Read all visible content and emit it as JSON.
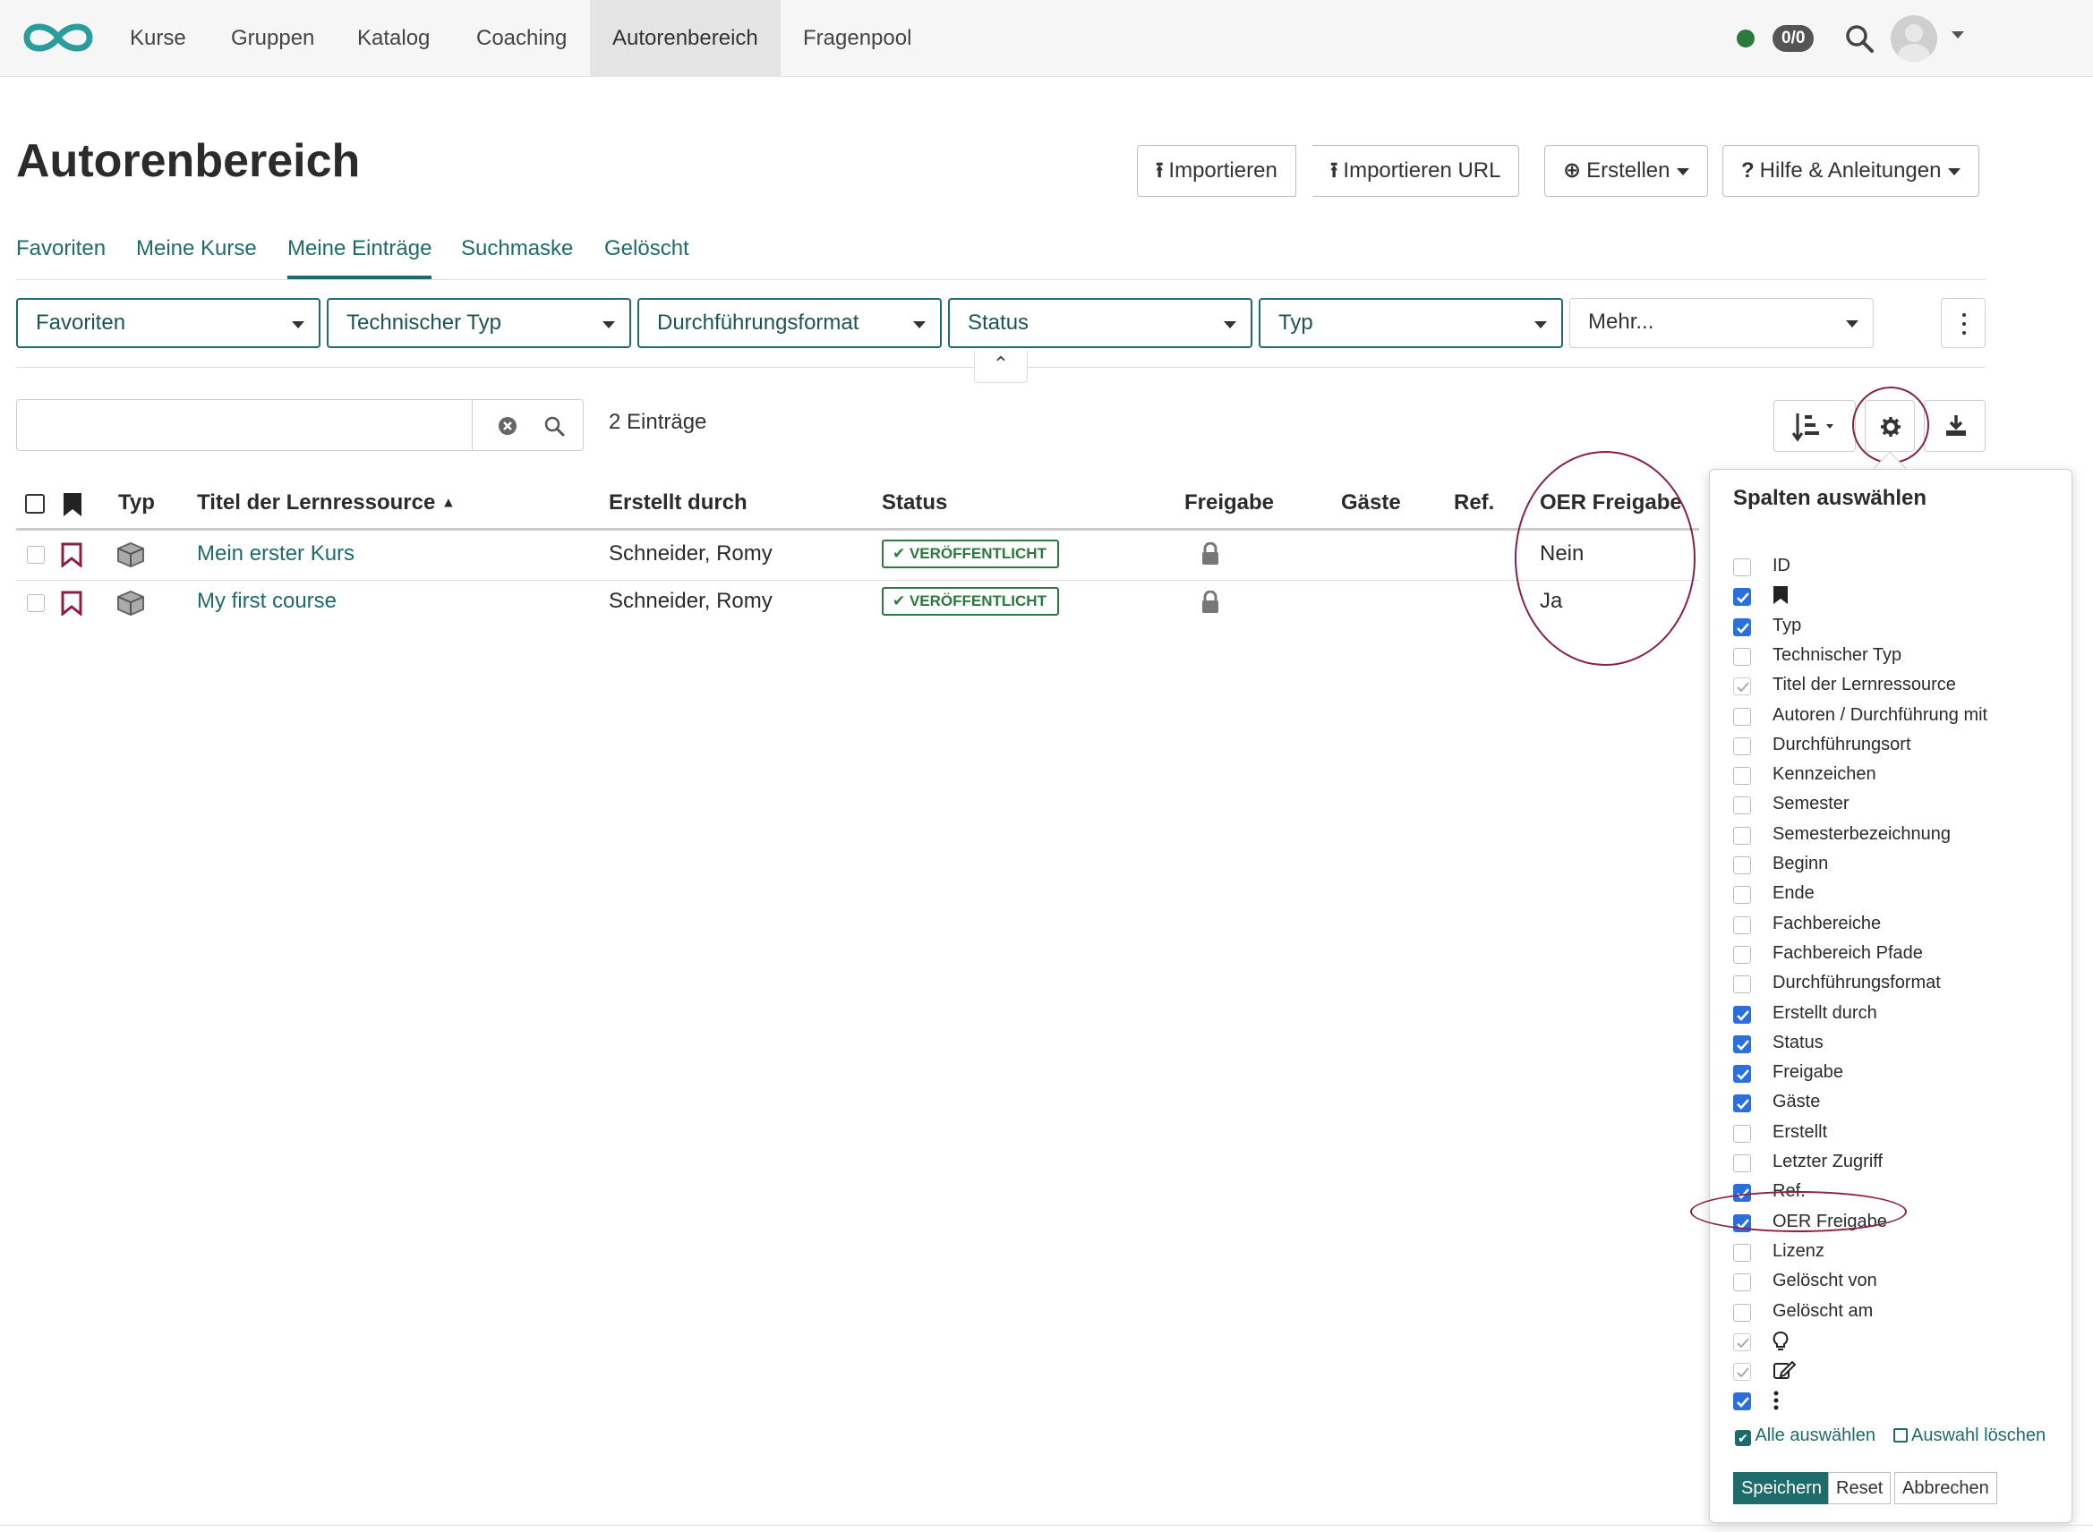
{
  "nav": {
    "items": [
      "Kurse",
      "Gruppen",
      "Katalog",
      "Coaching",
      "Autorenbereich",
      "Fragenpool"
    ],
    "active": "Autorenbereich",
    "counter": "0/0"
  },
  "page": {
    "title": "Autorenbereich"
  },
  "actions": {
    "import": "Importieren",
    "import_url": "Importieren URL",
    "create": "Erstellen",
    "help": "Hilfe & Anleitungen"
  },
  "tabs": [
    "Favoriten",
    "Meine Kurse",
    "Meine Einträge",
    "Suchmaske",
    "Gelöscht"
  ],
  "active_tab": "Meine Einträge",
  "filters": [
    "Favoriten",
    "Technischer Typ",
    "Durchführungsformat",
    "Status",
    "Typ",
    "Mehr..."
  ],
  "search": {
    "value": "",
    "placeholder": ""
  },
  "entries_count": "2 Einträge",
  "table": {
    "headers": {
      "type": "Typ",
      "title": "Titel der Lernressource",
      "created_by": "Erstellt durch",
      "status": "Status",
      "release": "Freigabe",
      "guests": "Gäste",
      "ref": "Ref.",
      "oer": "OER Freigabe"
    },
    "rows": [
      {
        "title": "Mein erster Kurs",
        "created_by": "Schneider, Romy",
        "status": "VERÖFFENTLICHT",
        "oer": "Nein"
      },
      {
        "title": "My first course",
        "created_by": "Schneider, Romy",
        "status": "VERÖFFENTLICHT",
        "oer": "Ja"
      }
    ]
  },
  "columns_popover": {
    "title": "Spalten auswählen",
    "options": [
      {
        "label": "ID",
        "state": "off"
      },
      {
        "label": "",
        "icon": "bookmark-icon",
        "state": "on"
      },
      {
        "label": "Typ",
        "state": "on"
      },
      {
        "label": "Technischer Typ",
        "state": "off"
      },
      {
        "label": "Titel der Lernressource",
        "state": "fixed"
      },
      {
        "label": "Autoren / Durchführung mit",
        "state": "off"
      },
      {
        "label": "Durchführungsort",
        "state": "off"
      },
      {
        "label": "Kennzeichen",
        "state": "off"
      },
      {
        "label": "Semester",
        "state": "off"
      },
      {
        "label": "Semesterbezeichnung",
        "state": "off"
      },
      {
        "label": "Beginn",
        "state": "off"
      },
      {
        "label": "Ende",
        "state": "off"
      },
      {
        "label": "Fachbereiche",
        "state": "off"
      },
      {
        "label": "Fachbereich Pfade",
        "state": "off"
      },
      {
        "label": "Durchführungsformat",
        "state": "off"
      },
      {
        "label": "Erstellt durch",
        "state": "on"
      },
      {
        "label": "Status",
        "state": "on"
      },
      {
        "label": "Freigabe",
        "state": "on"
      },
      {
        "label": "Gäste",
        "state": "on"
      },
      {
        "label": "Erstellt",
        "state": "off"
      },
      {
        "label": "Letzter Zugriff",
        "state": "off"
      },
      {
        "label": "Ref.",
        "state": "on"
      },
      {
        "label": "OER Freigabe",
        "state": "on"
      },
      {
        "label": "Lizenz",
        "state": "off"
      },
      {
        "label": "Gelöscht von",
        "state": "off"
      },
      {
        "label": "Gelöscht am",
        "state": "off"
      },
      {
        "label": "",
        "icon": "lightbulb-icon",
        "state": "fixed"
      },
      {
        "label": "",
        "icon": "edit-icon",
        "state": "fixed"
      },
      {
        "label": "",
        "icon": "kebab-icon",
        "state": "on"
      }
    ],
    "select_all": "Alle auswählen",
    "clear": "Auswahl löschen",
    "save": "Speichern",
    "reset": "Reset",
    "cancel": "Abbrechen"
  },
  "colors": {
    "accent": "#1d6b6b",
    "published": "#2b7a3b",
    "highlight": "#8a1f4a",
    "checkbox": "#2a6fdb"
  }
}
